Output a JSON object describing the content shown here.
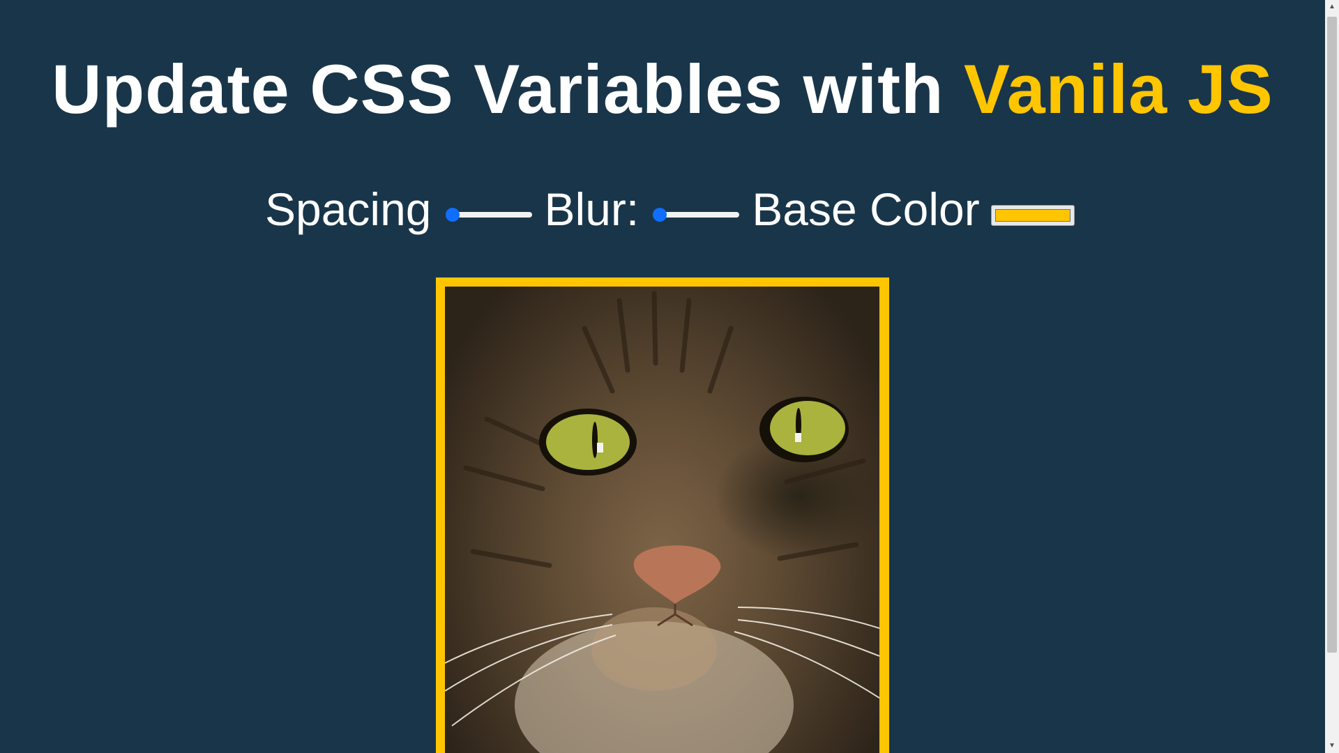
{
  "header": {
    "title_main": "Update CSS Variables with ",
    "title_highlight": "Vanila JS"
  },
  "controls": {
    "spacing_label": "Spacing",
    "spacing_value": 0,
    "blur_label": "Blur:",
    "blur_value": 0,
    "base_color_label": "Base Color",
    "base_color_value": "#ffc600"
  },
  "image": {
    "subject": "tabby cat close-up photo",
    "border_color": "#ffc600"
  },
  "colors": {
    "background": "#193549",
    "accent": "#ffc600",
    "slider_thumb": "#0f6efd"
  },
  "icons": {
    "scroll_up": "scroll-up-arrow-icon",
    "scroll_down": "scroll-down-arrow-icon"
  }
}
